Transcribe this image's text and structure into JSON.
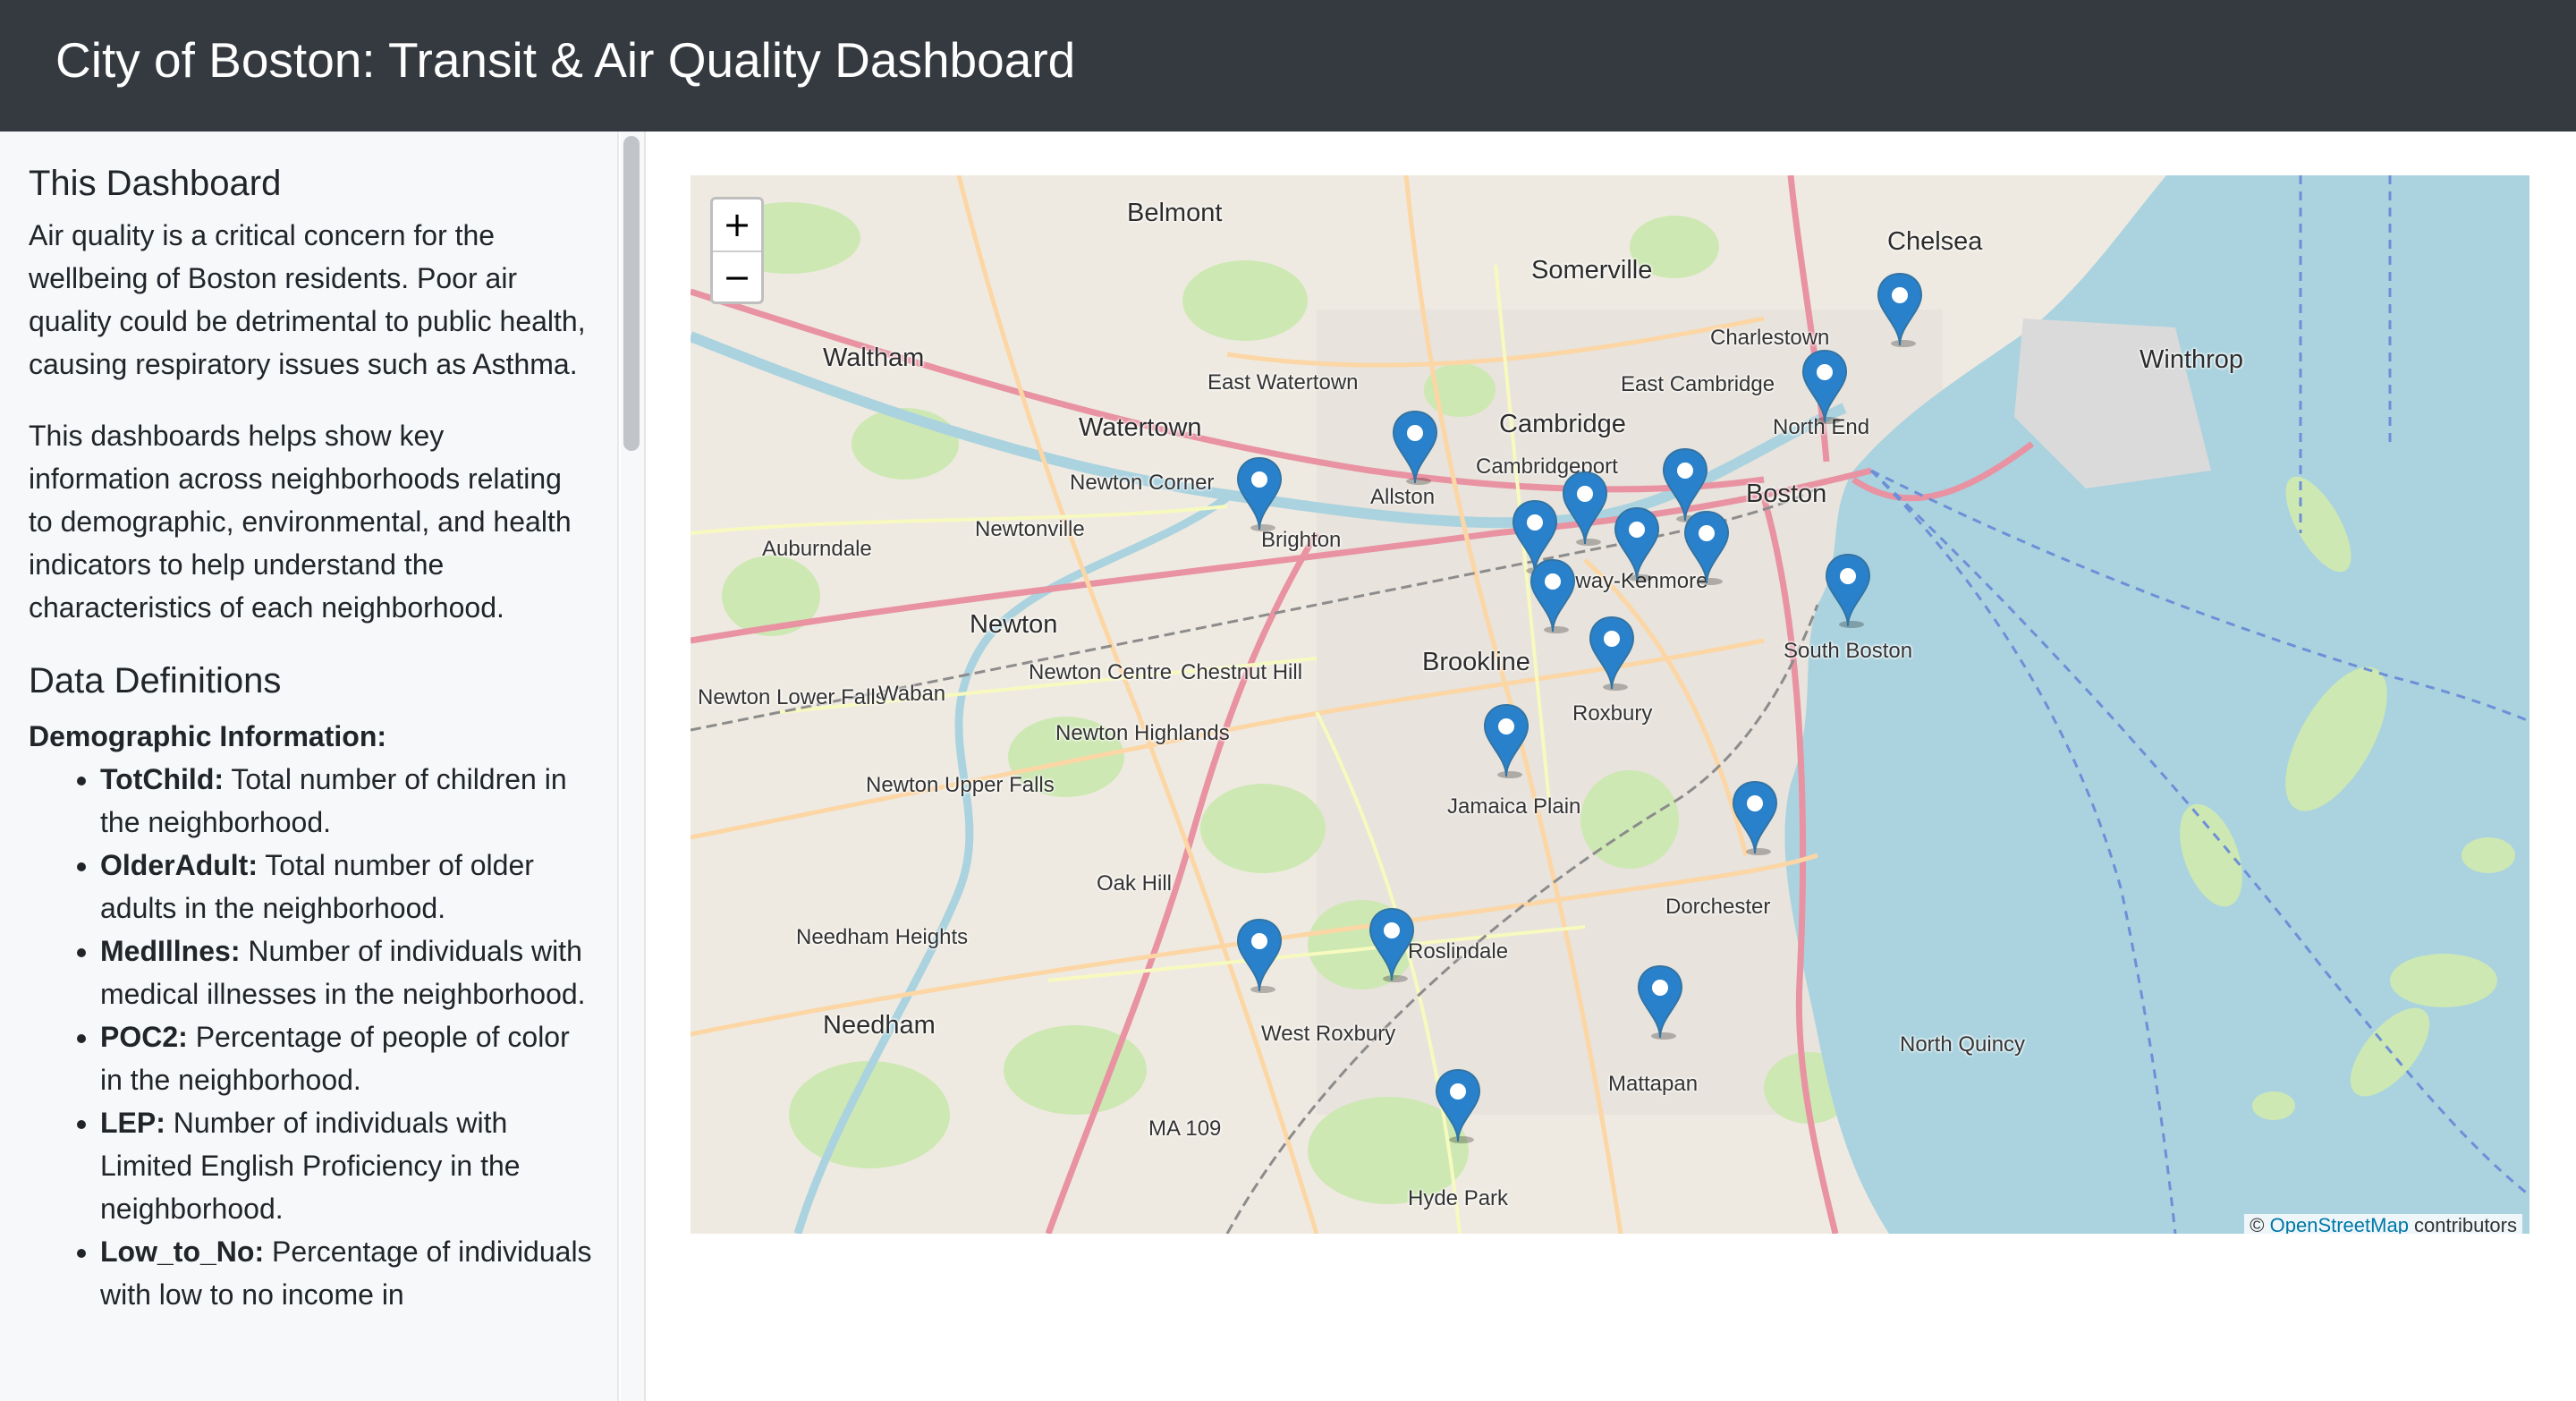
{
  "header": {
    "title": "City of Boston: Transit & Air Quality Dashboard"
  },
  "sidebar": {
    "about_heading": "This Dashboard",
    "about_p1": "Air quality is a critical concern for the wellbeing of Boston residents. Poor air quality could be detrimental to public health, causing respiratory issues such as Asthma.",
    "about_p2": "This dashboards helps show key information across neighborhoods relating to demographic, environmental, and health indicators to help understand the characteristics of each neighborhood.",
    "defs_heading": "Data Definitions",
    "demo_heading": "Demographic Information:",
    "definitions": [
      {
        "term": "TotChild:",
        "desc": " Total number of children in the neighborhood."
      },
      {
        "term": "OlderAdult:",
        "desc": " Total number of older adults in the neighborhood."
      },
      {
        "term": "MedIllnes:",
        "desc": " Number of individuals with medical illnesses in the neighborhood."
      },
      {
        "term": "POC2:",
        "desc": " Percentage of people of color in the neighborhood."
      },
      {
        "term": "LEP:",
        "desc": " Number of individuals with Limited English Proficiency in the neighborhood."
      },
      {
        "term": "Low_to_No:",
        "desc": " Percentage of individuals with low to no income in"
      }
    ]
  },
  "map": {
    "zoom_in": "+",
    "zoom_out": "−",
    "attribution_prefix": "© ",
    "attribution_link": "OpenStreetMap",
    "attribution_suffix": " contributors",
    "places": [
      {
        "name": "Belmont",
        "big": true
      },
      {
        "name": "Somerville",
        "big": true
      },
      {
        "name": "Chelsea",
        "big": true
      },
      {
        "name": "Waltham",
        "big": true
      },
      {
        "name": "Charlestown",
        "big": false
      },
      {
        "name": "Winthrop",
        "big": true
      },
      {
        "name": "East Watertown",
        "big": false
      },
      {
        "name": "East Cambridge",
        "big": false
      },
      {
        "name": "Watertown",
        "big": true
      },
      {
        "name": "Cambridge",
        "big": true
      },
      {
        "name": "North End",
        "big": false
      },
      {
        "name": "Newton Corner",
        "big": false
      },
      {
        "name": "Cambridgeport",
        "big": false
      },
      {
        "name": "Allston",
        "big": false
      },
      {
        "name": "Boston",
        "big": true
      },
      {
        "name": "Newtonville",
        "big": false
      },
      {
        "name": "Brighton",
        "big": false
      },
      {
        "name": "Auburndale",
        "big": false
      },
      {
        "name": "Fenway-Kenmore",
        "big": false
      },
      {
        "name": "Newton",
        "big": true
      },
      {
        "name": "South Boston",
        "big": false
      },
      {
        "name": "Newton Centre",
        "big": false
      },
      {
        "name": "Chestnut Hill",
        "big": false
      },
      {
        "name": "Brookline",
        "big": true
      },
      {
        "name": "Newton Lower Falls",
        "big": false
      },
      {
        "name": "Waban",
        "big": false
      },
      {
        "name": "Roxbury",
        "big": false
      },
      {
        "name": "Newton Highlands",
        "big": false
      },
      {
        "name": "Newton Upper Falls",
        "big": false
      },
      {
        "name": "Jamaica Plain",
        "big": false
      },
      {
        "name": "Oak Hill",
        "big": false
      },
      {
        "name": "Dorchester",
        "big": false
      },
      {
        "name": "Needham Heights",
        "big": false
      },
      {
        "name": "Roslindale",
        "big": false
      },
      {
        "name": "Needham",
        "big": true
      },
      {
        "name": "West Roxbury",
        "big": false
      },
      {
        "name": "North Quincy",
        "big": false
      },
      {
        "name": "Mattapan",
        "big": false
      },
      {
        "name": "MA 109",
        "big": false
      },
      {
        "name": "Hyde Park",
        "big": false
      }
    ],
    "markers": [
      "Chelsea",
      "North End",
      "Allston",
      "Brighton",
      "Back Bay",
      "Fenway",
      "Fenway-Kenmore South",
      "Longwood",
      "South End",
      "Mission Hill",
      "South Boston",
      "Roxbury",
      "Jamaica Plain",
      "Dorchester",
      "West Roxbury",
      "Roslindale",
      "Mattapan",
      "Hyde Park"
    ]
  }
}
